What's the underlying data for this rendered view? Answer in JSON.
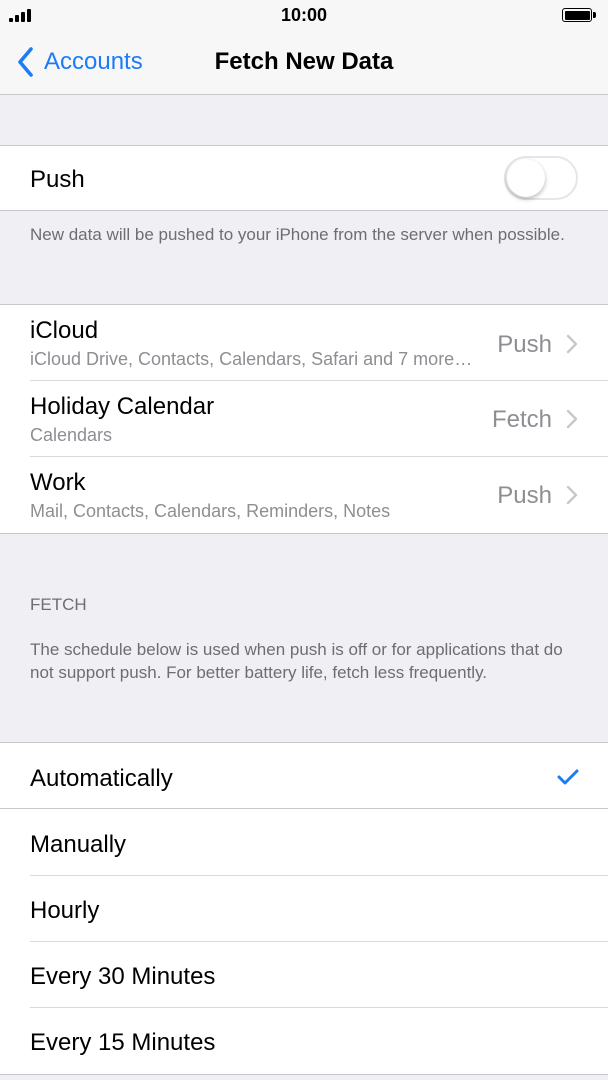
{
  "status_bar": {
    "time": "10:00"
  },
  "nav": {
    "back_label": "Accounts",
    "title": "Fetch New Data"
  },
  "push": {
    "label": "Push",
    "enabled": false,
    "footer": "New data will be pushed to your iPhone from the server when possible."
  },
  "accounts": [
    {
      "name": "iCloud",
      "details": "iCloud Drive, Contacts, Calendars, Safari and 7 more…",
      "status": "Push"
    },
    {
      "name": "Holiday Calendar",
      "details": "Calendars",
      "status": "Fetch"
    },
    {
      "name": "Work",
      "details": "Mail, Contacts, Calendars, Reminders, Notes",
      "status": "Push"
    }
  ],
  "fetch": {
    "header": "FETCH",
    "description": "The schedule below is used when push is off or for applications that do not support push. For better battery life, fetch less frequently.",
    "options": [
      "Automatically",
      "Manually",
      "Hourly",
      "Every 30 Minutes",
      "Every 15 Minutes"
    ],
    "selected": "Automatically"
  },
  "colors": {
    "accent": "#1c7cf5",
    "secondary_text": "#8e8e93",
    "group_background": "#efeff4"
  },
  "icons": {
    "back": "chevron-left-icon",
    "disclosure": "chevron-right-icon",
    "selected": "checkmark-icon"
  }
}
